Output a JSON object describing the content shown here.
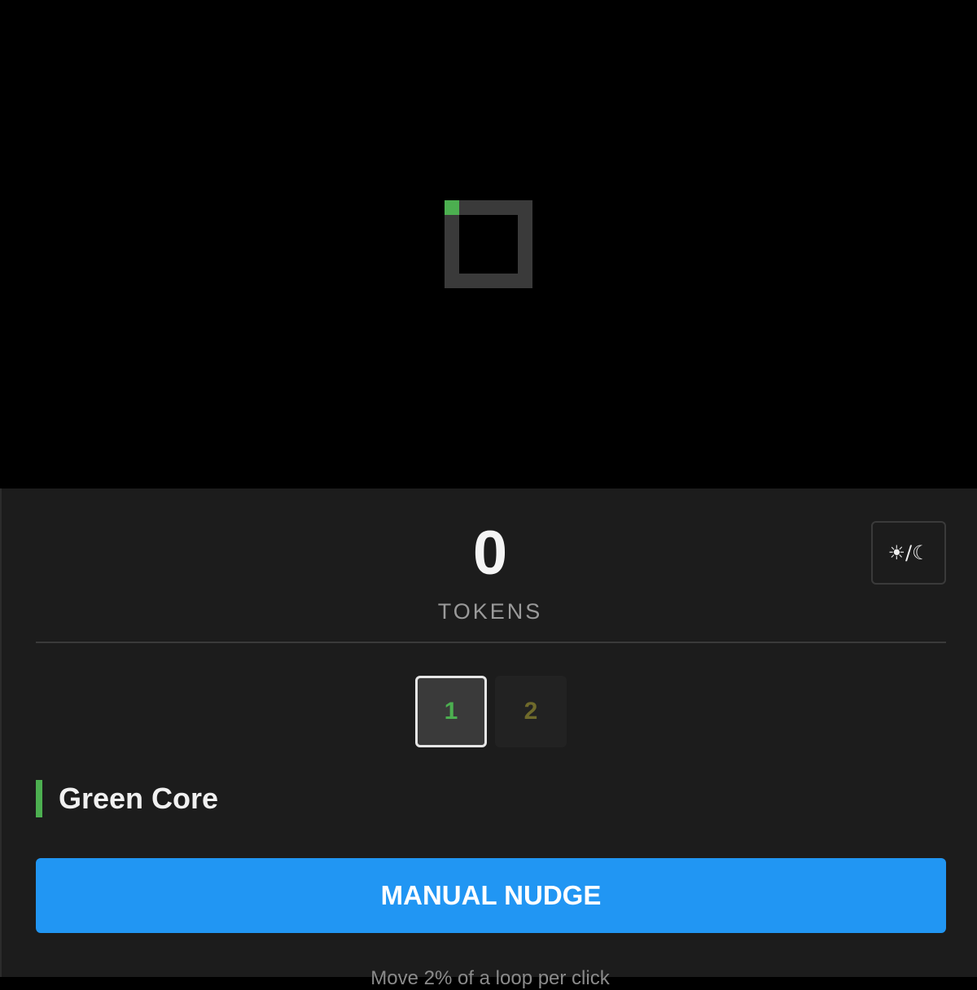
{
  "tokens": {
    "count": "0",
    "label": "TOKENS"
  },
  "theme_toggle": {
    "label": "☀/☾"
  },
  "levels": [
    {
      "label": "1",
      "selected": true
    },
    {
      "label": "2",
      "selected": false
    }
  ],
  "core": {
    "name": "Green Core",
    "color": "#4caf50"
  },
  "actions": {
    "nudge_label": "MANUAL NUDGE"
  },
  "hint": {
    "text": "Move 2% of a loop per click"
  },
  "colors": {
    "accent": "#2196f3",
    "core_green": "#4caf50",
    "track": "#3a3a3a"
  }
}
